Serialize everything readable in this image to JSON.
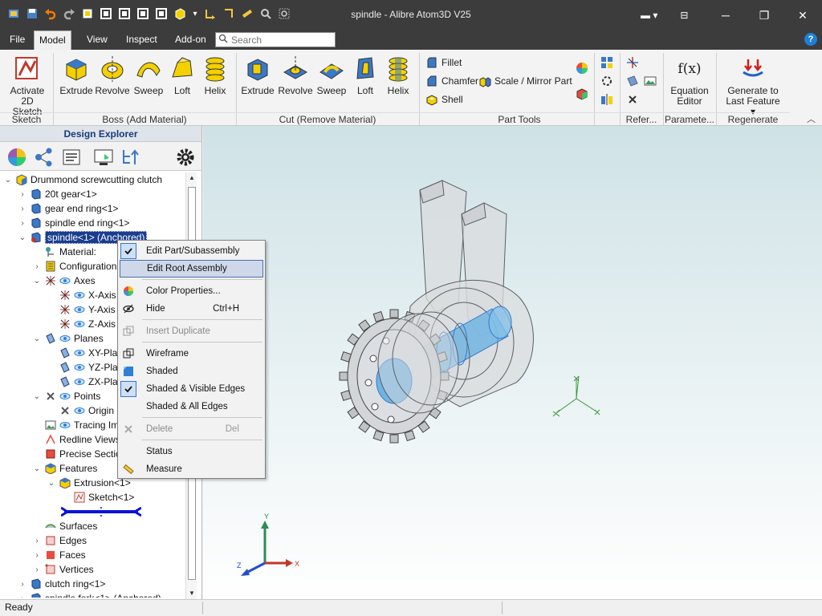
{
  "window": {
    "title": "spindle - Alibre Atom3D V25",
    "minimize": "─",
    "restore": "❐",
    "close": "✕"
  },
  "menu": {
    "tabs": [
      "File",
      "Model",
      "View",
      "Inspect",
      "Add-on"
    ],
    "active_tab": "Model",
    "search_placeholder": "Search",
    "help": "?"
  },
  "ribbon": {
    "sketch": {
      "activate_line1": "Activate",
      "activate_line2": "2D Sketch",
      "group": "Sketch"
    },
    "boss": {
      "items": [
        "Extrude",
        "Revolve",
        "Sweep",
        "Loft",
        "Helix"
      ],
      "group": "Boss (Add Material)"
    },
    "cut": {
      "items": [
        "Extrude",
        "Revolve",
        "Sweep",
        "Loft",
        "Helix"
      ],
      "group": "Cut (Remove Material)"
    },
    "part_tools": {
      "fillet": "Fillet",
      "chamfer": "Chamfer",
      "shell": "Shell",
      "scale_mirror": "Scale / Mirror Part",
      "group": "Part Tools"
    },
    "reference": {
      "group": "Refer..."
    },
    "parameters": {
      "equation_line1": "Equation",
      "equation_line2": "Editor",
      "equation_icon": "f(x)",
      "group": "Paramete..."
    },
    "regenerate": {
      "gen_line1": "Generate to",
      "gen_line2": "Last Feature",
      "group": "Regenerate"
    }
  },
  "explorer": {
    "title": "Design Explorer",
    "tree": [
      {
        "label": "Drummond screwcutting clutch"
      },
      {
        "label": "20t gear<1>"
      },
      {
        "label": "gear end ring<1>"
      },
      {
        "label": "spindle end ring<1>"
      },
      {
        "label": "spindle<1> (Anchored)"
      },
      {
        "label": "Material:"
      },
      {
        "label": "Configurations"
      },
      {
        "label": "Axes"
      },
      {
        "label": "X-Axis"
      },
      {
        "label": "Y-Axis"
      },
      {
        "label": "Z-Axis"
      },
      {
        "label": "Planes"
      },
      {
        "label": "XY-Pla"
      },
      {
        "label": "YZ-Pla"
      },
      {
        "label": "ZX-Pla"
      },
      {
        "label": "Points"
      },
      {
        "label": "Origin"
      },
      {
        "label": "Tracing Im"
      },
      {
        "label": "Redline Views"
      },
      {
        "label": "Precise Sectio"
      },
      {
        "label": "Features"
      },
      {
        "label": "Extrusion<1>"
      },
      {
        "label": "Sketch<1>"
      },
      {
        "label": "Surfaces"
      },
      {
        "label": "Edges"
      },
      {
        "label": "Faces"
      },
      {
        "label": "Vertices"
      },
      {
        "label": "clutch ring<1>"
      },
      {
        "label": "spindle fork<1> (Anchored)"
      }
    ]
  },
  "context_menu": {
    "items": [
      {
        "label": "Edit Part/Subassembly",
        "shortcut": ""
      },
      {
        "label": "Edit Root Assembly",
        "shortcut": ""
      },
      {
        "label": "Color Properties...",
        "shortcut": ""
      },
      {
        "label": "Hide",
        "shortcut": "Ctrl+H"
      },
      {
        "label": "Insert Duplicate",
        "shortcut": ""
      },
      {
        "label": "Wireframe",
        "shortcut": ""
      },
      {
        "label": "Shaded",
        "shortcut": ""
      },
      {
        "label": "Shaded & Visible Edges",
        "shortcut": ""
      },
      {
        "label": "Shaded & All Edges",
        "shortcut": ""
      },
      {
        "label": "Delete",
        "shortcut": "Del"
      },
      {
        "label": "Status",
        "shortcut": ""
      },
      {
        "label": "Measure",
        "shortcut": ""
      }
    ]
  },
  "viewport": {
    "triad_labels": {
      "x": "X",
      "y": "Y",
      "z": "Z"
    }
  },
  "status": {
    "text": "Ready"
  },
  "colors": {
    "accent": "#1a3d8f",
    "titlebar": "#3c3c3c"
  }
}
